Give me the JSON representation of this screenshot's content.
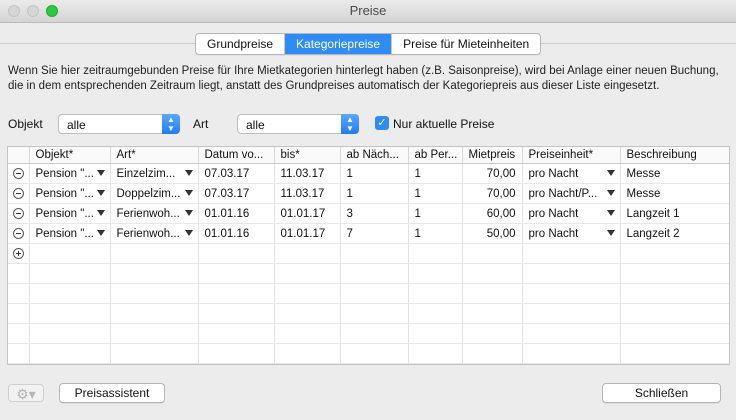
{
  "window": {
    "title": "Preise"
  },
  "tabs": [
    {
      "label": "Grundpreise",
      "active": false
    },
    {
      "label": "Kategoriepreise",
      "active": true
    },
    {
      "label": "Preise für Mieteinheiten",
      "active": false
    }
  ],
  "description": "Wenn Sie hier zeitraumgebunden Preise für Ihre Mietkategorien hinterlegt haben (z.B. Saisonpreise), wird bei Anlage einer neuen Buchung, die in dem entsprechenden Zeitraum liegt,  anstatt des Grundpreises automatisch der Kategoriepreis aus dieser Liste eingesetzt.",
  "filters": {
    "objekt_label": "Objekt",
    "objekt_value": "alle",
    "art_label": "Art",
    "art_value": "alle",
    "only_current_label": "Nur aktuelle Preise",
    "only_current_checked": true
  },
  "table": {
    "columns": [
      "Objekt*",
      "Art*",
      "Datum vo...",
      "bis*",
      "ab Näch...",
      "ab Per...",
      "Mietpreis",
      "Preiseinheit*",
      "Beschreibung"
    ],
    "rows": [
      {
        "objekt": "Pension \"...",
        "art": "Einzelzim...",
        "von": "07.03.17",
        "bis": "11.03.17",
        "naechte": "1",
        "personen": "1",
        "preis": "70,00",
        "einheit": "pro Nacht",
        "beschreibung": "Messe"
      },
      {
        "objekt": "Pension \"...",
        "art": "Doppelzim...",
        "von": "07.03.17",
        "bis": "11.03.17",
        "naechte": "1",
        "personen": "1",
        "preis": "70,00",
        "einheit": "pro Nacht/P...",
        "beschreibung": "Messe"
      },
      {
        "objekt": "Pension \"...",
        "art": "Ferienwoh...",
        "von": "01.01.16",
        "bis": "01.01.17",
        "naechte": "3",
        "personen": "1",
        "preis": "60,00",
        "einheit": "pro Nacht",
        "beschreibung": "Langzeit 1"
      },
      {
        "objekt": "Pension \"...",
        "art": "Ferienwoh...",
        "von": "01.01.16",
        "bis": "01.01.17",
        "naechte": "7",
        "personen": "1",
        "preis": "50,00",
        "einheit": "pro Nacht",
        "beschreibung": "Langzeit 2"
      }
    ]
  },
  "buttons": {
    "assistant": "Preisassistent",
    "close": "Schließen"
  },
  "colors": {
    "accent": "#2f8cf4"
  }
}
